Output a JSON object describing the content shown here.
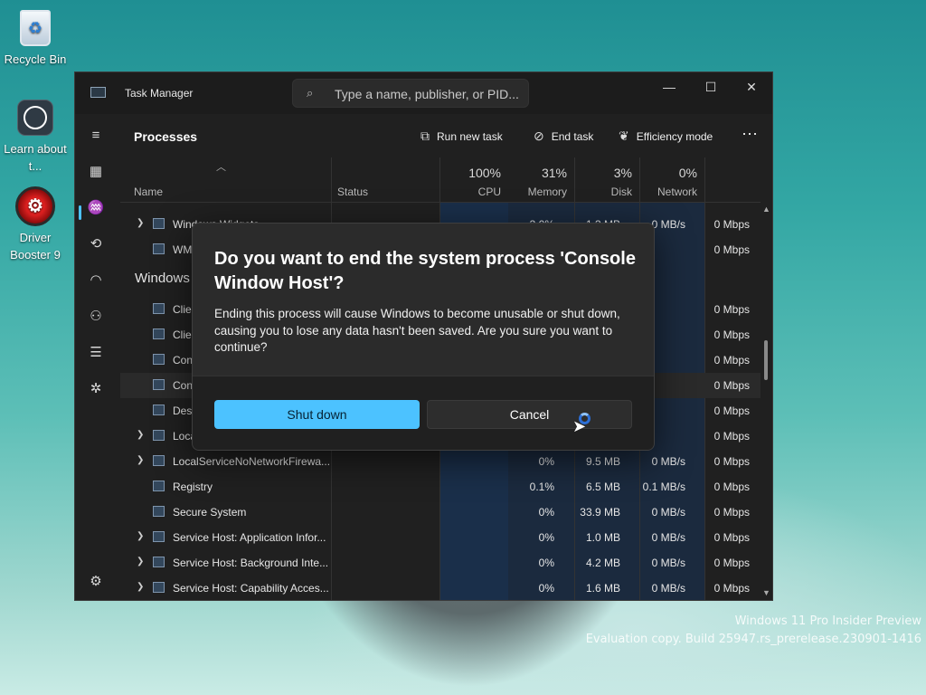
{
  "desktop": {
    "icons": [
      {
        "label": "Recycle Bin",
        "icon": "recycle-bin-icon"
      },
      {
        "label": "Learn about t...",
        "icon": "learn-icon"
      },
      {
        "label": "Driver Booster 9",
        "icon": "driver-booster-icon"
      }
    ],
    "watermark_line1": "Windows 11 Pro Insider Preview",
    "watermark_line2": "Evaluation copy. Build 25947.rs_prerelease.230901-1416"
  },
  "task_manager": {
    "title": "Task Manager",
    "search_placeholder": "Type a name, publisher, or PID...",
    "page_title": "Processes",
    "toolbar": {
      "run_new_task": "Run new task",
      "end_task": "End task",
      "efficiency_mode": "Efficiency mode",
      "more": "⋯"
    },
    "columns": {
      "name": "Name",
      "status": "Status",
      "cpu_pct": "100%",
      "cpu": "CPU",
      "memory_pct": "31%",
      "memory": "Memory",
      "disk_pct": "3%",
      "disk": "Disk",
      "network_pct": "0%",
      "network": "Network"
    },
    "group_windows": "Windows",
    "rows": [
      {
        "name": "Windows Widgets",
        "cpu": "3.0%",
        "memory": "1.3 MB",
        "disk": "0 MB/s",
        "network": "0 Mbps"
      },
      {
        "name": "WMI",
        "cpu": "",
        "memory": "",
        "disk": "",
        "network": "0 Mbps"
      },
      {
        "name": "Client",
        "network": "0 Mbps"
      },
      {
        "name": "Client",
        "network": "0 Mbps"
      },
      {
        "name": "Console",
        "network": "0 Mbps"
      },
      {
        "name": "Console",
        "network": "0 Mbps"
      },
      {
        "name": "Desk",
        "network": "0 Mbps"
      },
      {
        "name": "Local",
        "network": "0 Mbps"
      },
      {
        "name": "LocalServiceNoNetworkFirewa...",
        "cpu": "0%",
        "memory": "9.5 MB",
        "disk": "0 MB/s",
        "network": "0 Mbps"
      },
      {
        "name": "Registry",
        "cpu": "0.1%",
        "memory": "6.5 MB",
        "disk": "0.1 MB/s",
        "network": "0 Mbps"
      },
      {
        "name": "Secure System",
        "cpu": "0%",
        "memory": "33.9 MB",
        "disk": "0 MB/s",
        "network": "0 Mbps"
      },
      {
        "name": "Service Host: Application Infor...",
        "cpu": "0%",
        "memory": "1.0 MB",
        "disk": "0 MB/s",
        "network": "0 Mbps"
      },
      {
        "name": "Service Host: Background Inte...",
        "cpu": "0%",
        "memory": "4.2 MB",
        "disk": "0 MB/s",
        "network": "0 Mbps"
      },
      {
        "name": "Service Host: Capability Acces...",
        "cpu": "0%",
        "memory": "1.6 MB",
        "disk": "0 MB/s",
        "network": "0 Mbps"
      }
    ]
  },
  "dialog": {
    "title": "Do you want to end the system process 'Console Window Host'?",
    "body": "Ending this process will cause Windows to become unusable or shut down, causing you to lose any data hasn't been saved. Are you sure you want to continue?",
    "primary_button": "Shut down",
    "secondary_button": "Cancel"
  },
  "colors": {
    "accent": "#4cc2ff",
    "window_bg": "#202020",
    "dialog_bg": "#2b2b2b"
  }
}
